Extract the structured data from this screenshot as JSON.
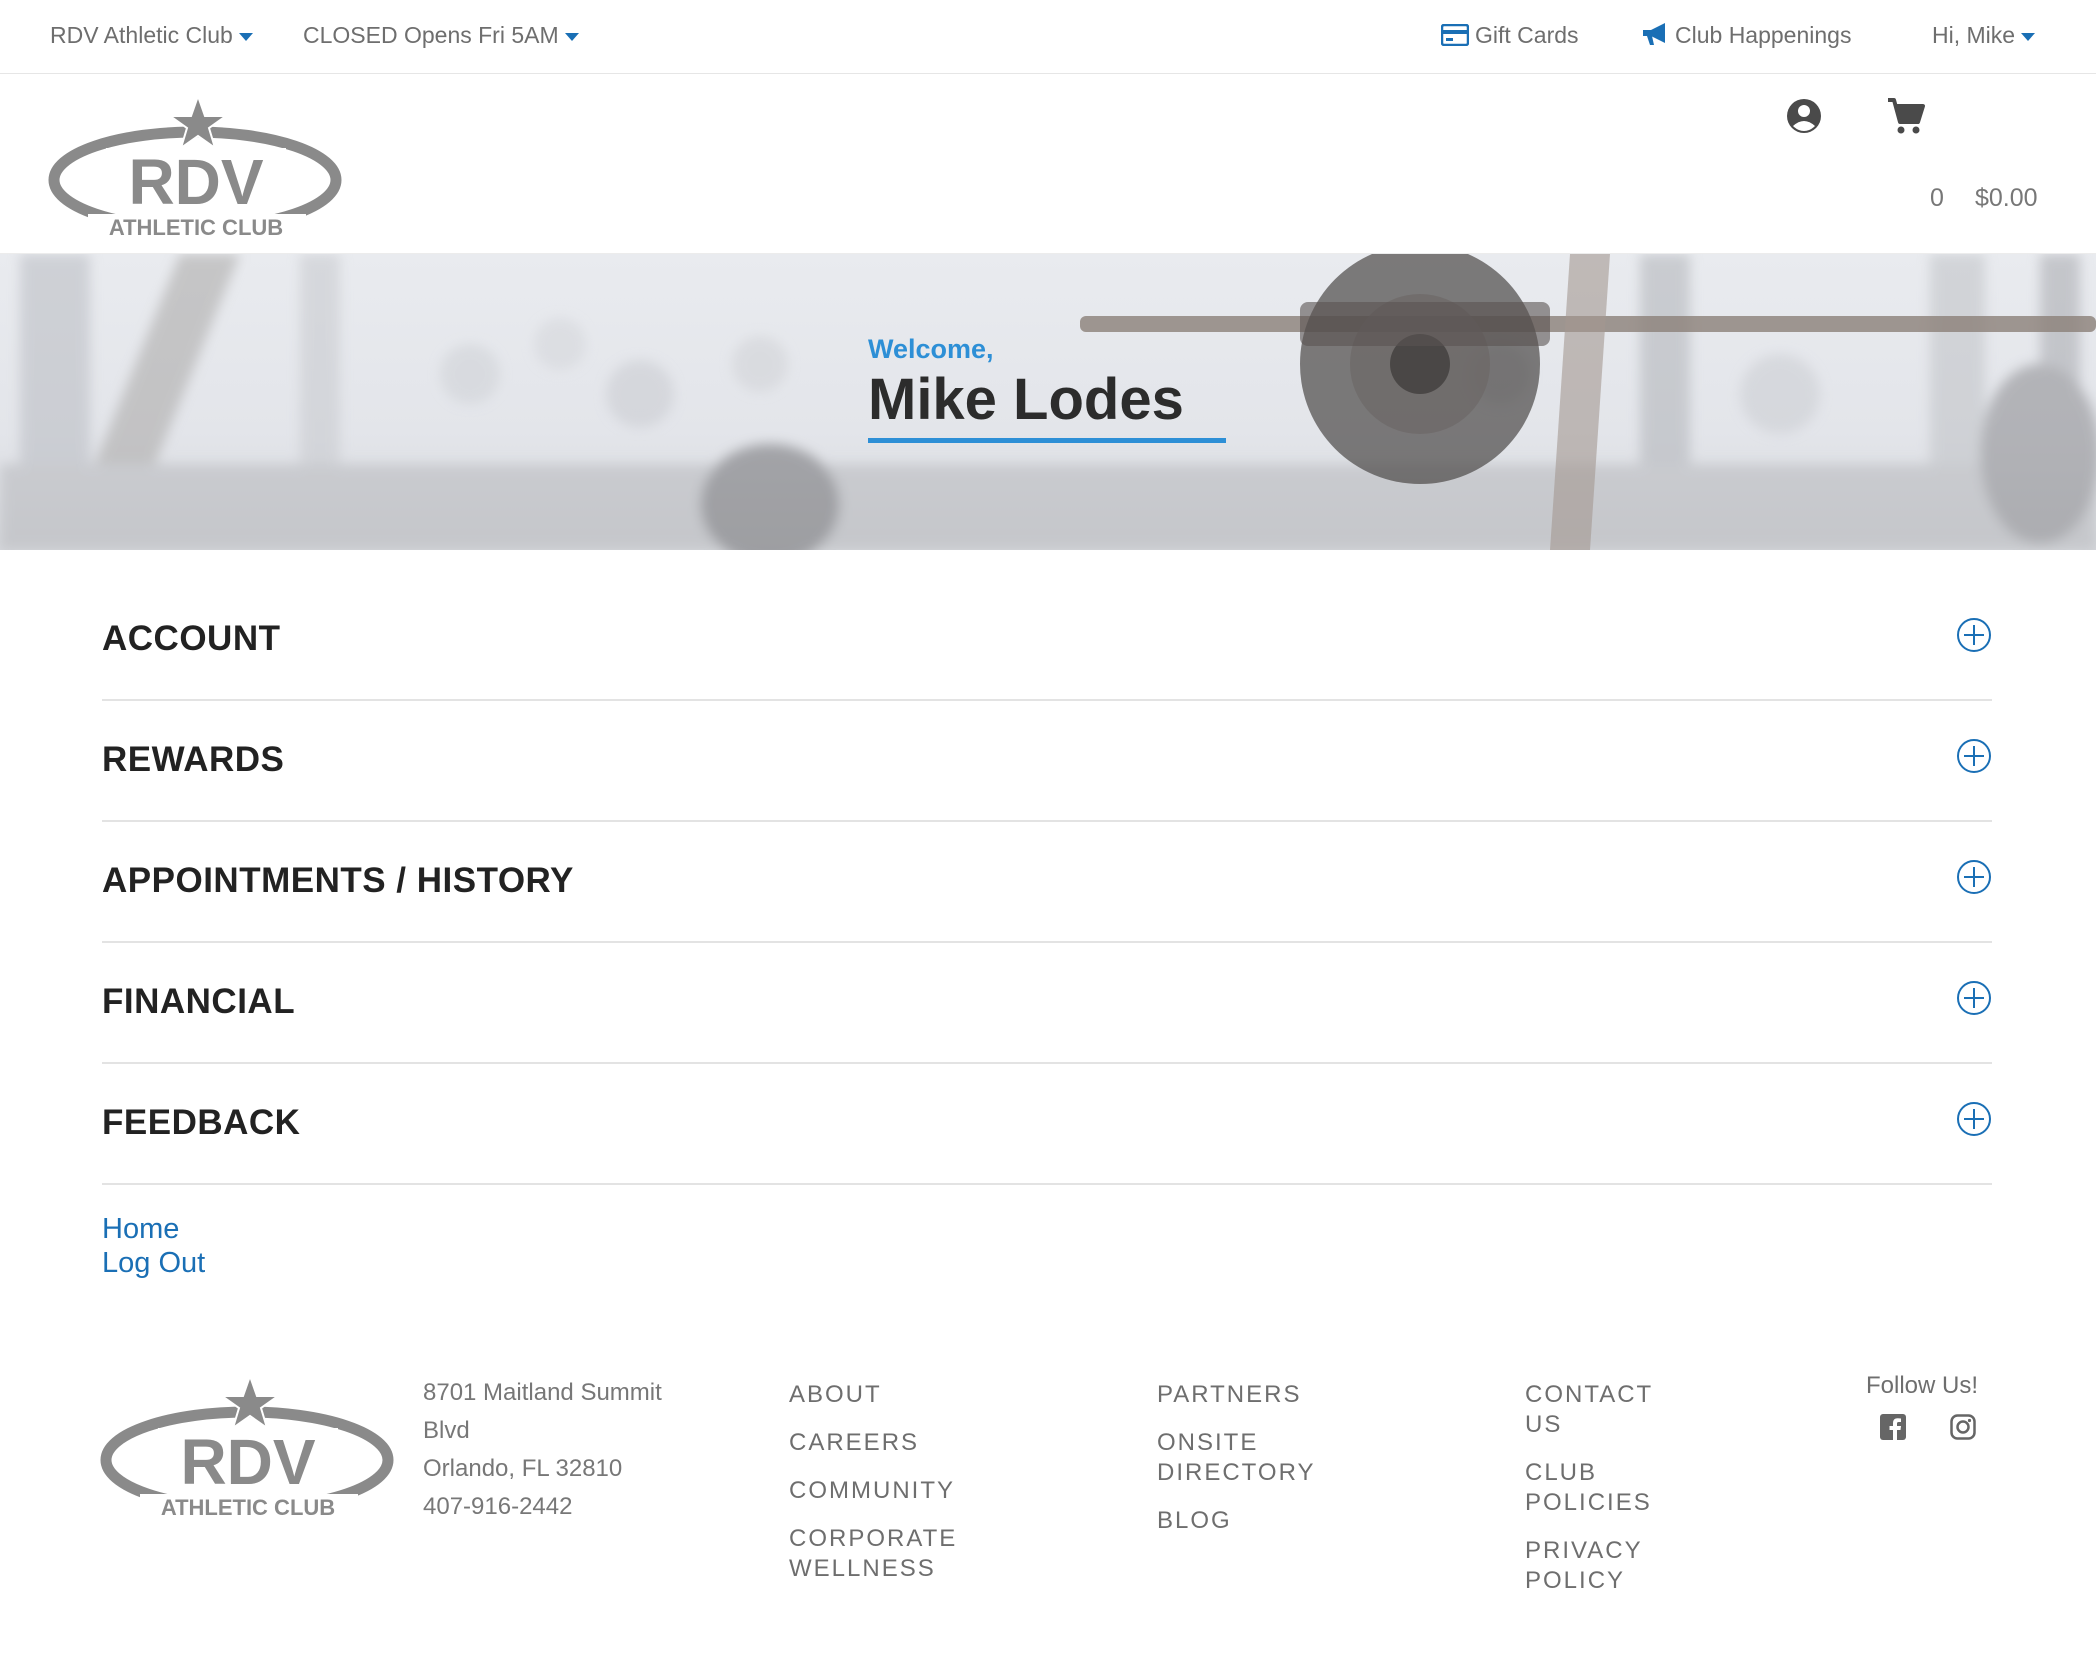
{
  "topbar": {
    "club_selector": "RDV Athletic Club",
    "hours_status": "CLOSED Opens Fri 5AM",
    "gift_cards": "Gift Cards",
    "club_happenings": "Club Happenings",
    "greeting": "Hi, Mike"
  },
  "logo": {
    "text": "RDV",
    "subtext": "ATHLETIC CLUB"
  },
  "header": {
    "cart_count": "0",
    "cart_total": "$0.00"
  },
  "hero": {
    "welcome": "Welcome,",
    "member_name": "Mike Lodes"
  },
  "accordion": [
    {
      "title": "ACCOUNT"
    },
    {
      "title": "REWARDS"
    },
    {
      "title": "APPOINTMENTS / HISTORY"
    },
    {
      "title": "FINANCIAL"
    },
    {
      "title": "FEEDBACK"
    }
  ],
  "links": {
    "home": "Home",
    "logout": "Log Out"
  },
  "footer": {
    "address_line1": "8701 Maitland Summit",
    "address_line2": "Blvd",
    "address_line3": "Orlando, FL 32810",
    "phone": "407-916-2442",
    "col1": [
      "ABOUT",
      "CAREERS",
      "COMMUNITY",
      "CORPORATE WELLNESS"
    ],
    "col2": [
      "PARTNERS",
      "ONSITE DIRECTORY",
      "BLOG"
    ],
    "col3": [
      "CONTACT US",
      "CLUB POLICIES",
      "PRIVACY POLICY"
    ],
    "follow_label": "Follow Us!",
    "social": [
      "facebook-icon",
      "instagram-icon"
    ]
  },
  "colors": {
    "accent": "#2d8fd6",
    "link": "#1a6fb5",
    "heading": "#222222"
  }
}
